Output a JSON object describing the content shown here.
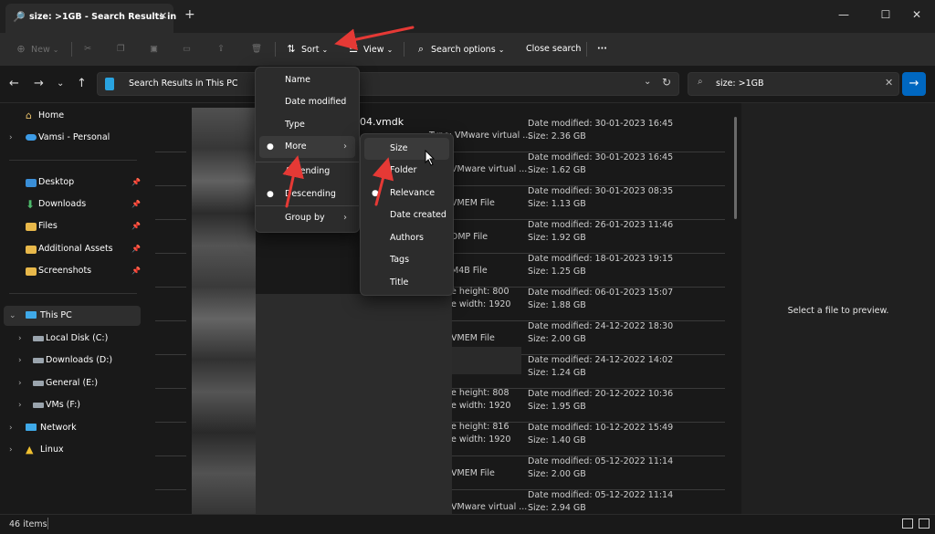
{
  "tab": {
    "title": "size: >1GB - Search Results in",
    "close": "✕",
    "new": "+"
  },
  "window": {
    "minimize": "—",
    "maximize": "☐",
    "close": "✕"
  },
  "toolbar": {
    "new_label": "New",
    "sort_label": "Sort",
    "view_label": "View",
    "search_options_label": "Search options",
    "close_search_label": "Close search",
    "more_label": "···"
  },
  "address": {
    "text": "Search Results in This PC"
  },
  "search": {
    "value": "size: >1GB"
  },
  "sidebar": {
    "items": [
      {
        "label": "Home"
      },
      {
        "label": "Vamsi - Personal"
      },
      {
        "label": "Desktop"
      },
      {
        "label": "Downloads"
      },
      {
        "label": "Files"
      },
      {
        "label": "Additional Assets"
      },
      {
        "label": "Screenshots"
      },
      {
        "label": "This PC"
      },
      {
        "label": "Local Disk (C:)"
      },
      {
        "label": "Downloads (D:)"
      },
      {
        "label": "General (E:)"
      },
      {
        "label": "VMs (F:)"
      },
      {
        "label": "Network"
      },
      {
        "label": "Linux"
      }
    ]
  },
  "files": [
    {
      "name": "04.vmdk",
      "type": "Type: VMware virtual ...",
      "date": "Date modified: 30-01-2023 16:45",
      "size": "Size: 2.36 GB"
    },
    {
      "type": "VMware virtual ...",
      "date": "Date modified: 30-01-2023 16:45",
      "size": "Size: 1.62 GB"
    },
    {
      "type": "VMEM File",
      "date": "Date modified: 30-01-2023 08:35",
      "size": "Size: 1.13 GB"
    },
    {
      "type": "DMP File",
      "date": "Date modified: 26-01-2023 11:46",
      "size": "Size: 1.92 GB"
    },
    {
      "type": "M4B File",
      "date": "Date modified: 18-01-2023 19:15",
      "size": "Size: 1.25 GB"
    },
    {
      "type": "e height: 800",
      "type2": "e width: 1920",
      "date": "Date modified: 06-01-2023 15:07",
      "size": "Size: 1.88 GB"
    },
    {
      "type": "VMEM File",
      "date": "Date modified: 24-12-2022 18:30",
      "size": "Size: 2.00 GB"
    },
    {
      "type": "",
      "date": "Date modified: 24-12-2022 14:02",
      "size": "Size: 1.24 GB"
    },
    {
      "type": "e height: 808",
      "type2": "e width: 1920",
      "date": "Date modified: 20-12-2022 10:36",
      "size": "Size: 1.95 GB"
    },
    {
      "type": "e height: 816",
      "type2": "e width: 1920",
      "date": "Date modified: 10-12-2022 15:49",
      "size": "Size: 1.40 GB"
    },
    {
      "type": "VMEM File",
      "date": "Date modified: 05-12-2022 11:14",
      "size": "Size: 2.00 GB"
    },
    {
      "type": "VMware virtual ...",
      "date": "Date modified: 05-12-2022 11:14",
      "size": "Size: 2.94 GB"
    }
  ],
  "sort_menu": {
    "items": [
      "Name",
      "Date modified",
      "Type",
      "More",
      "Ascending",
      "Descending",
      "Group by"
    ]
  },
  "more_menu": {
    "items": [
      "Size",
      "Folder",
      "Relevance",
      "Date created",
      "Authors",
      "Tags",
      "Title"
    ]
  },
  "preview": {
    "text": "Select a file to preview."
  },
  "status": {
    "count": "46 items"
  }
}
